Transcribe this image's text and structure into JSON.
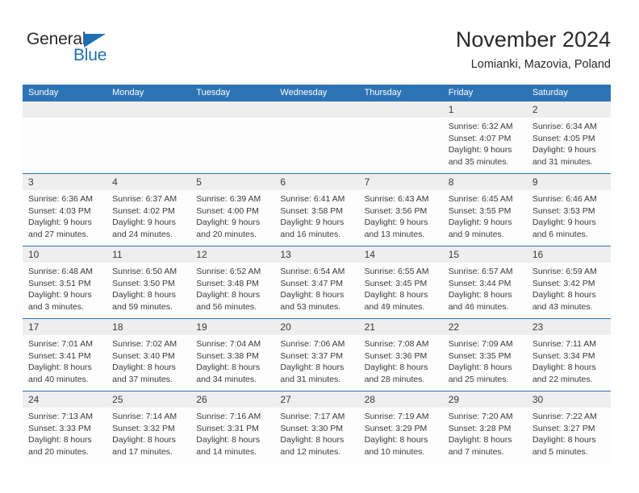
{
  "brand": {
    "name_top": "General",
    "name_bottom": "Blue",
    "accent_color": "#1f6fb5"
  },
  "header": {
    "title": "November 2024",
    "subtitle": "Lomianki, Mazovia, Poland"
  },
  "theme": {
    "header_blue": "#2d74b5",
    "day_band_gray": "#eeeeee",
    "text_color": "#3a3a3a"
  },
  "weekdays": [
    "Sunday",
    "Monday",
    "Tuesday",
    "Wednesday",
    "Thursday",
    "Friday",
    "Saturday"
  ],
  "weeks": [
    [
      {
        "day": "",
        "sunrise": "",
        "sunset": "",
        "daylight_1": "",
        "daylight_2": "",
        "empty": true
      },
      {
        "day": "",
        "sunrise": "",
        "sunset": "",
        "daylight_1": "",
        "daylight_2": "",
        "empty": true
      },
      {
        "day": "",
        "sunrise": "",
        "sunset": "",
        "daylight_1": "",
        "daylight_2": "",
        "empty": true
      },
      {
        "day": "",
        "sunrise": "",
        "sunset": "",
        "daylight_1": "",
        "daylight_2": "",
        "empty": true
      },
      {
        "day": "",
        "sunrise": "",
        "sunset": "",
        "daylight_1": "",
        "daylight_2": "",
        "empty": true
      },
      {
        "day": "1",
        "sunrise": "Sunrise: 6:32 AM",
        "sunset": "Sunset: 4:07 PM",
        "daylight_1": "Daylight: 9 hours",
        "daylight_2": "and 35 minutes."
      },
      {
        "day": "2",
        "sunrise": "Sunrise: 6:34 AM",
        "sunset": "Sunset: 4:05 PM",
        "daylight_1": "Daylight: 9 hours",
        "daylight_2": "and 31 minutes."
      }
    ],
    [
      {
        "day": "3",
        "sunrise": "Sunrise: 6:36 AM",
        "sunset": "Sunset: 4:03 PM",
        "daylight_1": "Daylight: 9 hours",
        "daylight_2": "and 27 minutes."
      },
      {
        "day": "4",
        "sunrise": "Sunrise: 6:37 AM",
        "sunset": "Sunset: 4:02 PM",
        "daylight_1": "Daylight: 9 hours",
        "daylight_2": "and 24 minutes."
      },
      {
        "day": "5",
        "sunrise": "Sunrise: 6:39 AM",
        "sunset": "Sunset: 4:00 PM",
        "daylight_1": "Daylight: 9 hours",
        "daylight_2": "and 20 minutes."
      },
      {
        "day": "6",
        "sunrise": "Sunrise: 6:41 AM",
        "sunset": "Sunset: 3:58 PM",
        "daylight_1": "Daylight: 9 hours",
        "daylight_2": "and 16 minutes."
      },
      {
        "day": "7",
        "sunrise": "Sunrise: 6:43 AM",
        "sunset": "Sunset: 3:56 PM",
        "daylight_1": "Daylight: 9 hours",
        "daylight_2": "and 13 minutes."
      },
      {
        "day": "8",
        "sunrise": "Sunrise: 6:45 AM",
        "sunset": "Sunset: 3:55 PM",
        "daylight_1": "Daylight: 9 hours",
        "daylight_2": "and 9 minutes."
      },
      {
        "day": "9",
        "sunrise": "Sunrise: 6:46 AM",
        "sunset": "Sunset: 3:53 PM",
        "daylight_1": "Daylight: 9 hours",
        "daylight_2": "and 6 minutes."
      }
    ],
    [
      {
        "day": "10",
        "sunrise": "Sunrise: 6:48 AM",
        "sunset": "Sunset: 3:51 PM",
        "daylight_1": "Daylight: 9 hours",
        "daylight_2": "and 3 minutes."
      },
      {
        "day": "11",
        "sunrise": "Sunrise: 6:50 AM",
        "sunset": "Sunset: 3:50 PM",
        "daylight_1": "Daylight: 8 hours",
        "daylight_2": "and 59 minutes."
      },
      {
        "day": "12",
        "sunrise": "Sunrise: 6:52 AM",
        "sunset": "Sunset: 3:48 PM",
        "daylight_1": "Daylight: 8 hours",
        "daylight_2": "and 56 minutes."
      },
      {
        "day": "13",
        "sunrise": "Sunrise: 6:54 AM",
        "sunset": "Sunset: 3:47 PM",
        "daylight_1": "Daylight: 8 hours",
        "daylight_2": "and 53 minutes."
      },
      {
        "day": "14",
        "sunrise": "Sunrise: 6:55 AM",
        "sunset": "Sunset: 3:45 PM",
        "daylight_1": "Daylight: 8 hours",
        "daylight_2": "and 49 minutes."
      },
      {
        "day": "15",
        "sunrise": "Sunrise: 6:57 AM",
        "sunset": "Sunset: 3:44 PM",
        "daylight_1": "Daylight: 8 hours",
        "daylight_2": "and 46 minutes."
      },
      {
        "day": "16",
        "sunrise": "Sunrise: 6:59 AM",
        "sunset": "Sunset: 3:42 PM",
        "daylight_1": "Daylight: 8 hours",
        "daylight_2": "and 43 minutes."
      }
    ],
    [
      {
        "day": "17",
        "sunrise": "Sunrise: 7:01 AM",
        "sunset": "Sunset: 3:41 PM",
        "daylight_1": "Daylight: 8 hours",
        "daylight_2": "and 40 minutes."
      },
      {
        "day": "18",
        "sunrise": "Sunrise: 7:02 AM",
        "sunset": "Sunset: 3:40 PM",
        "daylight_1": "Daylight: 8 hours",
        "daylight_2": "and 37 minutes."
      },
      {
        "day": "19",
        "sunrise": "Sunrise: 7:04 AM",
        "sunset": "Sunset: 3:38 PM",
        "daylight_1": "Daylight: 8 hours",
        "daylight_2": "and 34 minutes."
      },
      {
        "day": "20",
        "sunrise": "Sunrise: 7:06 AM",
        "sunset": "Sunset: 3:37 PM",
        "daylight_1": "Daylight: 8 hours",
        "daylight_2": "and 31 minutes."
      },
      {
        "day": "21",
        "sunrise": "Sunrise: 7:08 AM",
        "sunset": "Sunset: 3:36 PM",
        "daylight_1": "Daylight: 8 hours",
        "daylight_2": "and 28 minutes."
      },
      {
        "day": "22",
        "sunrise": "Sunrise: 7:09 AM",
        "sunset": "Sunset: 3:35 PM",
        "daylight_1": "Daylight: 8 hours",
        "daylight_2": "and 25 minutes."
      },
      {
        "day": "23",
        "sunrise": "Sunrise: 7:11 AM",
        "sunset": "Sunset: 3:34 PM",
        "daylight_1": "Daylight: 8 hours",
        "daylight_2": "and 22 minutes."
      }
    ],
    [
      {
        "day": "24",
        "sunrise": "Sunrise: 7:13 AM",
        "sunset": "Sunset: 3:33 PM",
        "daylight_1": "Daylight: 8 hours",
        "daylight_2": "and 20 minutes."
      },
      {
        "day": "25",
        "sunrise": "Sunrise: 7:14 AM",
        "sunset": "Sunset: 3:32 PM",
        "daylight_1": "Daylight: 8 hours",
        "daylight_2": "and 17 minutes."
      },
      {
        "day": "26",
        "sunrise": "Sunrise: 7:16 AM",
        "sunset": "Sunset: 3:31 PM",
        "daylight_1": "Daylight: 8 hours",
        "daylight_2": "and 14 minutes."
      },
      {
        "day": "27",
        "sunrise": "Sunrise: 7:17 AM",
        "sunset": "Sunset: 3:30 PM",
        "daylight_1": "Daylight: 8 hours",
        "daylight_2": "and 12 minutes."
      },
      {
        "day": "28",
        "sunrise": "Sunrise: 7:19 AM",
        "sunset": "Sunset: 3:29 PM",
        "daylight_1": "Daylight: 8 hours",
        "daylight_2": "and 10 minutes."
      },
      {
        "day": "29",
        "sunrise": "Sunrise: 7:20 AM",
        "sunset": "Sunset: 3:28 PM",
        "daylight_1": "Daylight: 8 hours",
        "daylight_2": "and 7 minutes."
      },
      {
        "day": "30",
        "sunrise": "Sunrise: 7:22 AM",
        "sunset": "Sunset: 3:27 PM",
        "daylight_1": "Daylight: 8 hours",
        "daylight_2": "and 5 minutes."
      }
    ]
  ]
}
